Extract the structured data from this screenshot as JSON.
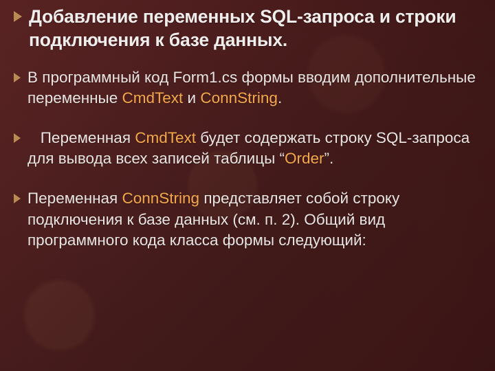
{
  "colors": {
    "highlight": "#f4a94a",
    "bullet": "#b98a52",
    "text": "#e8e5e3"
  },
  "title": "Добавление переменных SQL-запроса и строки подключения к базе данных.",
  "para1": {
    "pre": "В программный код Form1.cs формы вводим дополнительные переменные ",
    "hl1": "CmdText",
    "mid": " и ",
    "hl2": "ConnString",
    "post": "."
  },
  "para2": {
    "preIndent": "   Переменная ",
    "hl1": "CmdText",
    "mid": " будет содержать строку SQL-запроса для вывода всех записей таблицы “",
    "hl2": "Order",
    "post": "”."
  },
  "para3": {
    "pre": "Переменная ",
    "hl1": "ConnString",
    "post": " представляет собой строку подключения к базе данных (см. п. 2). Общий вид программного кода класса формы следующий:"
  }
}
